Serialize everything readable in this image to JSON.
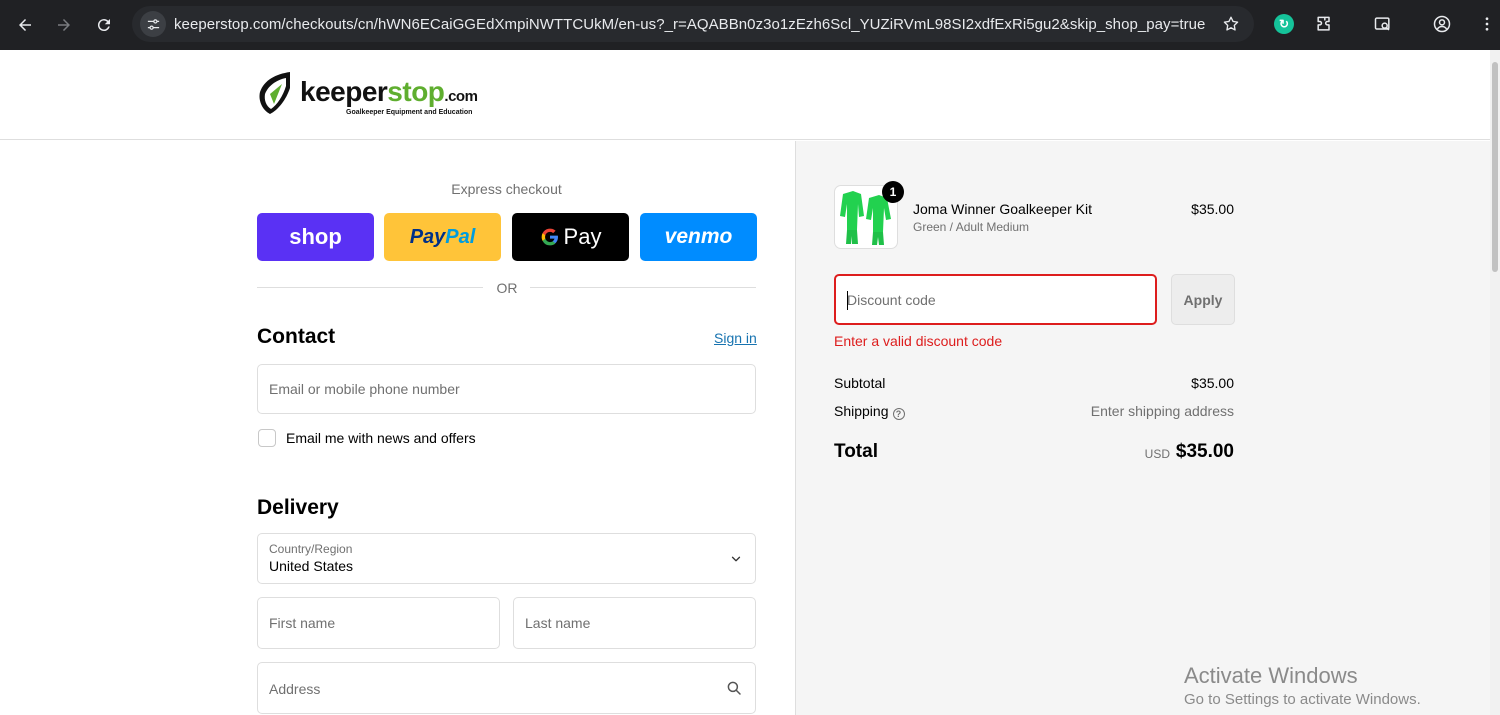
{
  "browser": {
    "url_host": "keeperstop.com",
    "url_path": "/checkouts/cn/hWN6ECaiGGEdXmpiNWTTCUkM/en-us?_r=AQABBn0z3o1zEzh6Scl_YUZiRVmL98SI2xdfExRi5gu2&skip_shop_pay=true",
    "icons": [
      "back-icon",
      "forward-icon",
      "reload-icon",
      "site-info-icon",
      "star-icon",
      "grammarly-icon",
      "extensions-icon",
      "tab-search-icon",
      "profile-icon"
    ]
  },
  "header": {
    "logo_text_a": "keeper",
    "logo_text_b": "stop",
    "logo_text_c": ".com",
    "logo_tagline": "Goalkeeper Equipment and Education"
  },
  "express": {
    "title": "Express checkout",
    "shop_label": "shop",
    "paypal_a": "Pay",
    "paypal_b": "Pal",
    "gpay_g": "G",
    "gpay_label": "Pay",
    "venmo_label": "venmo",
    "or": "OR"
  },
  "contact": {
    "heading": "Contact",
    "signin": "Sign in",
    "email_placeholder": "Email or mobile phone number",
    "newsletter_label": "Email me with news and offers"
  },
  "delivery": {
    "heading": "Delivery",
    "country_label": "Country/Region",
    "country_value": "United States",
    "first_name_placeholder": "First name",
    "last_name_placeholder": "Last name",
    "address_placeholder": "Address"
  },
  "summary": {
    "quantity": "1",
    "product_name": "Joma Winner Goalkeeper Kit",
    "product_variant": "Green / Adult Medium",
    "product_price": "$35.00",
    "product_color": "#22d14f",
    "discount_placeholder": "Discount code",
    "apply_label": "Apply",
    "discount_error": "Enter a valid discount code",
    "subtotal_label": "Subtotal",
    "subtotal_value": "$35.00",
    "shipping_label": "Shipping",
    "shipping_value": "Enter shipping address",
    "total_label": "Total",
    "total_currency": "USD",
    "total_value": "$35.00"
  },
  "watermark": {
    "line1": "Activate Windows",
    "line2": "Go to Settings to activate Windows."
  },
  "colors": {
    "shop": "#5a31f4",
    "paypal": "#ffc439",
    "venmo": "#008cff",
    "error": "#dd1d1d",
    "link": "#1773b0"
  }
}
